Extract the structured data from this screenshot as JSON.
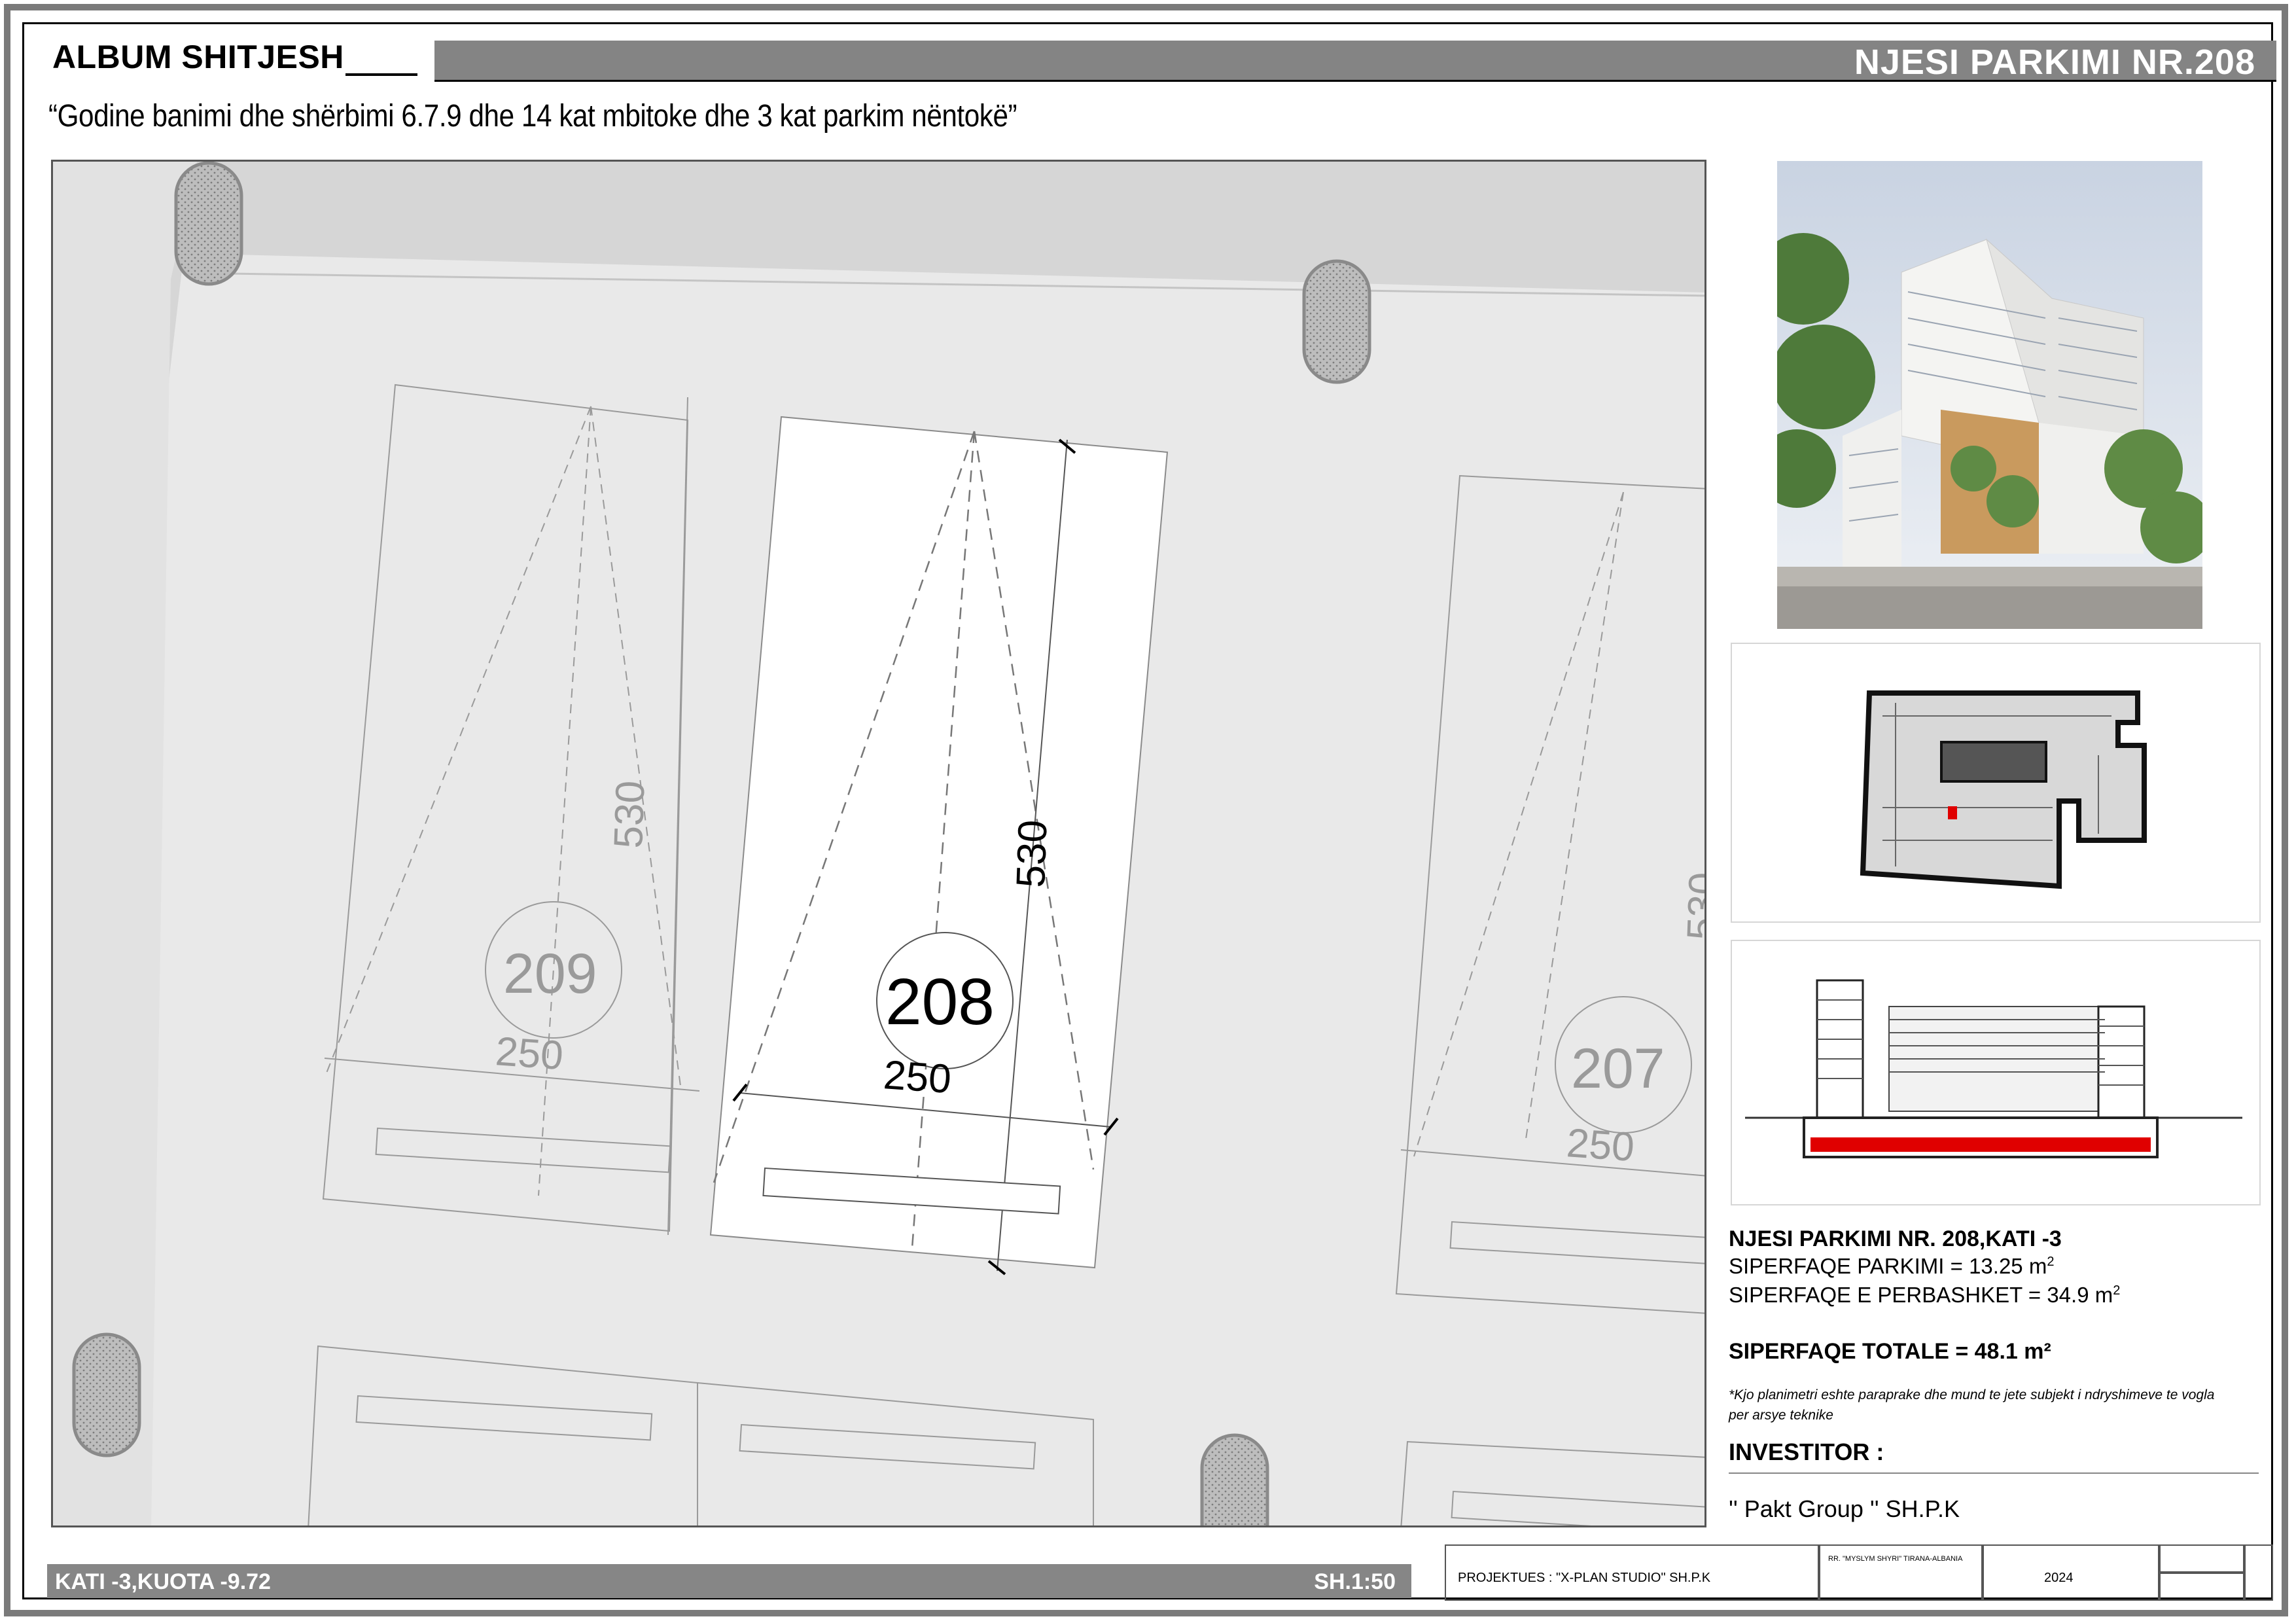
{
  "header": {
    "album_title": "ALBUM SHITJESH",
    "unit_title": "NJESI PARKIMI NR.208",
    "subtitle": "“Godine banimi dhe shërbimi 6.7.9 dhe 14 kat mbitoke dhe 3 kat parkim nëntokë”"
  },
  "plan": {
    "spots": [
      {
        "number": "208",
        "length": "530",
        "width": "250"
      },
      {
        "number": "209",
        "length": "530",
        "width": "250"
      },
      {
        "number": "207",
        "length": "530",
        "width": "250"
      }
    ],
    "colors": {
      "background": "#e9e9e9",
      "highlight": "#ffffff",
      "line": "#9a9a9a"
    }
  },
  "info": {
    "title": "NJESI PARKIMI NR. 208,KATI -3",
    "parking_area": "SIPERFAQE PARKIMI = 13.25 m",
    "shared_area": "SIPERFAQE E PERBASHKET = 34.9 m",
    "superscript": "2",
    "total_area": "SIPERFAQE TOTALE = 48.1 m²",
    "note": "*Kjo planimetri eshte paraprake dhe mund te jete subjekt i ndryshimeve te vogla per arsye teknike",
    "investor_label": "INVESTITOR :",
    "investor_name": "'' Pakt Group '' SH.P.K",
    "highlight_color": "#e00000"
  },
  "footer": {
    "floor_level": "KATI -3,KUOTA -9.72",
    "scale": "SH.1:50",
    "designer": "PROJEKTUES :  \"X-PLAN STUDIO\" SH.P.K",
    "address": "RR. \"MYSLYM SHYRI\" TIRANA-ALBANIA",
    "year": "2024"
  }
}
